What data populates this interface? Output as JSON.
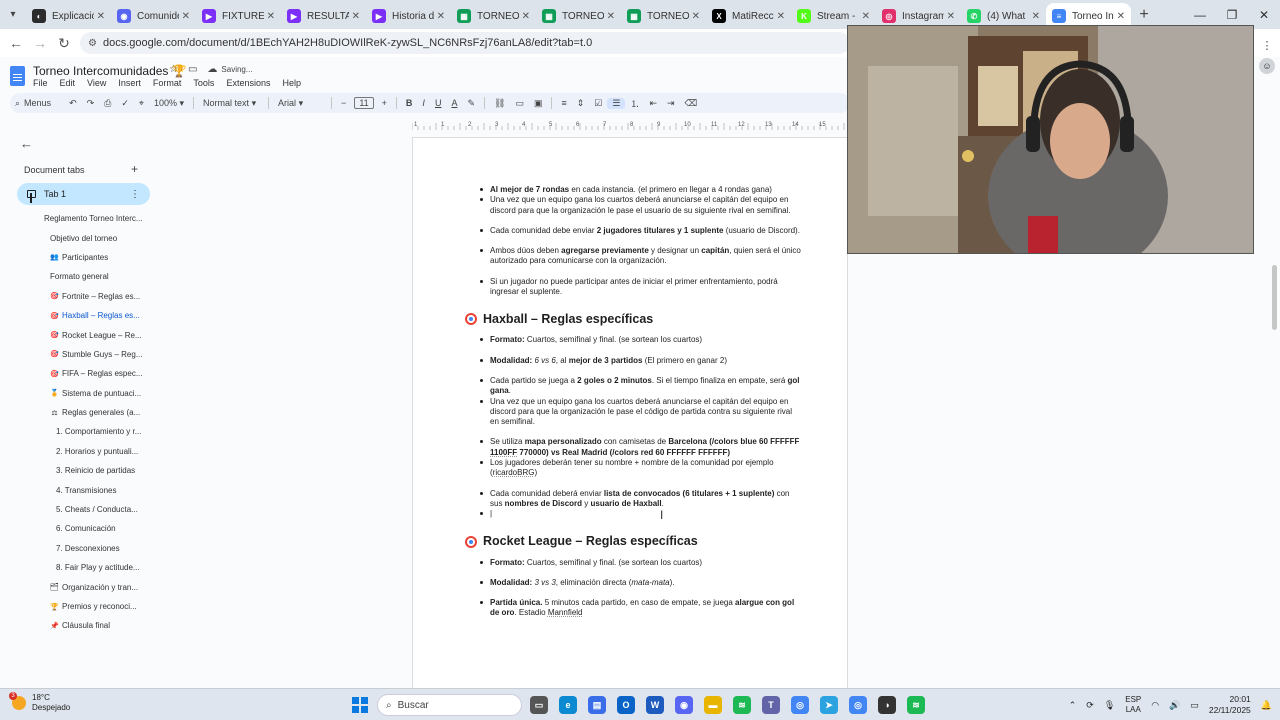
{
  "browser": {
    "tabs": [
      {
        "title": "Explicació",
        "color": "#2b2b2b",
        "glyph": "◐"
      },
      {
        "title": "Comunide",
        "color": "#5865f2",
        "glyph": "◉"
      },
      {
        "title": "FIXTURE",
        "color": "#7b2ff7",
        "glyph": "▶"
      },
      {
        "title": "RESULTAD",
        "color": "#7b2ff7",
        "glyph": "▶"
      },
      {
        "title": "Historia d",
        "color": "#7b2ff7",
        "glyph": "▶"
      },
      {
        "title": "TORNEO I",
        "color": "#0f9d58",
        "glyph": "▦"
      },
      {
        "title": "TORNEO I",
        "color": "#0f9d58",
        "glyph": "▦"
      },
      {
        "title": "TORNEO I",
        "color": "#0f9d58",
        "glyph": "▦"
      },
      {
        "title": "MatiRecch",
        "color": "#000000",
        "glyph": "X"
      },
      {
        "title": "Stream -",
        "color": "#53fc18",
        "glyph": "K"
      },
      {
        "title": "Instagram",
        "color": "#e1306c",
        "glyph": "◎"
      },
      {
        "title": "(4) What",
        "color": "#25d366",
        "glyph": "✆"
      },
      {
        "title": "Torneo Int",
        "color": "#4285f4",
        "glyph": "≡"
      }
    ],
    "close_glyph": "✕",
    "url": "docs.google.com/document/d/1BEchYAH2H8uDIOWIlReK-zywSL_NC6NRsFzj76anLA8/edit?tab=t.0",
    "back_glyph": "←",
    "forward_glyph": "→",
    "reload_glyph": "↻",
    "menu_glyph": "▾",
    "new_tab_glyph": "+",
    "minimize": "—",
    "maximize": "❐",
    "close": "✕"
  },
  "doc": {
    "title": "Torneo Intercomunidades 🏆",
    "star": "☆",
    "status": "Saving...",
    "menus": [
      "File",
      "Edit",
      "View",
      "Insert",
      "Format",
      "Tools",
      "Extensions",
      "Help"
    ]
  },
  "toolbar": {
    "search": "Menus",
    "zoom": "100%",
    "style": "Normal text",
    "font": "Arial",
    "font_size": "11",
    "minus": "−",
    "plus": "+",
    "undo": "↶",
    "redo": "↷",
    "print": "⎙",
    "spell": "✓",
    "paint": "⌖",
    "bold": "B",
    "italic": "I",
    "underline": "U",
    "textcolor": "A",
    "highlight": "✎",
    "link": "⛓",
    "comment": "▭",
    "image": "▣",
    "align": "≡",
    "linespacing": "⇕",
    "checklist": "☑",
    "bullets": "☰",
    "numbered": "⒈",
    "indent_less": "⇤",
    "indent_more": "⇥",
    "clear": "⌫"
  },
  "sidebar": {
    "back": "←",
    "header": "Document tabs",
    "add": "+",
    "active_tab": "Tab 1",
    "kebab": "⋮",
    "outline": [
      {
        "label": "Reglamento Torneo Interc...",
        "indent": 44,
        "emoji": "",
        "active": false
      },
      {
        "label": "Objetivo del torneo",
        "indent": 50,
        "emoji": "",
        "active": false
      },
      {
        "label": "Participantes",
        "indent": 50,
        "emoji": "👥",
        "active": false
      },
      {
        "label": "Formato general",
        "indent": 50,
        "emoji": "",
        "active": false
      },
      {
        "label": "Fortnite – Reglas es...",
        "indent": 50,
        "emoji": "🎯",
        "active": false
      },
      {
        "label": "Haxball – Reglas es...",
        "indent": 50,
        "emoji": "🎯",
        "active": true
      },
      {
        "label": "Rocket League – Re...",
        "indent": 50,
        "emoji": "🎯",
        "active": false
      },
      {
        "label": "Stumble Guys – Reg...",
        "indent": 50,
        "emoji": "🎯",
        "active": false
      },
      {
        "label": "FIFA – Reglas espec...",
        "indent": 50,
        "emoji": "🎯",
        "active": false
      },
      {
        "label": "Sistema de puntuaci...",
        "indent": 50,
        "emoji": "🏅",
        "active": false
      },
      {
        "label": "Reglas generales (a...",
        "indent": 50,
        "emoji": "⚖",
        "active": false
      },
      {
        "label": "1. Comportamiento y r...",
        "indent": 56,
        "emoji": "",
        "active": false
      },
      {
        "label": "2. Horarios y puntuali...",
        "indent": 56,
        "emoji": "",
        "active": false
      },
      {
        "label": "3. Reinicio de partidas",
        "indent": 56,
        "emoji": "",
        "active": false
      },
      {
        "label": "4. Transmisiones",
        "indent": 56,
        "emoji": "",
        "active": false
      },
      {
        "label": "5. Cheats / Conducta...",
        "indent": 56,
        "emoji": "",
        "active": false
      },
      {
        "label": "6. Comunicación",
        "indent": 56,
        "emoji": "",
        "active": false
      },
      {
        "label": "7. Desconexiones",
        "indent": 56,
        "emoji": "",
        "active": false
      },
      {
        "label": "8. Fair Play y actitude...",
        "indent": 56,
        "emoji": "",
        "active": false
      },
      {
        "label": "Organización y tran...",
        "indent": 50,
        "emoji": "🗂",
        "active": false
      },
      {
        "label": "Premios y reconoci...",
        "indent": 50,
        "emoji": "🏆",
        "active": false
      },
      {
        "label": "Cláusula final",
        "indent": 50,
        "emoji": "📌",
        "active": false
      }
    ]
  },
  "content": {
    "top_items": [
      {
        "html": "<b>Al mejor de 7 rondas</b> en cada instancia. (el primero en llegar a 4 rondas gana)"
      },
      {
        "html": "Una vez que un equipo gana los cuartos deberá anunciarse el capitán del equipo en discord para que la organización le pase el usuario de su siguiente rival en semifinal."
      },
      {
        "html": "Cada comunidad debe enviar <b>2 jugadores titulares y 1 suplente</b> (usuario de Discord).",
        "gap": true
      },
      {
        "html": "Ambos dúos deben <b>agregarse previamente</b> y designar un <b>capitán</b>, quien será el único autorizado para comunicarse con la organización.",
        "gap": true
      },
      {
        "html": "Si un jugador no puede participar antes de iniciar el primer enfrentamiento, podrá ingresar el suplente.",
        "gap": true
      }
    ],
    "haxball_heading": "Haxball – Reglas específicas",
    "haxball_items": [
      {
        "html": "<b>Formato:</b> Cuartos, semifinal y final. (se sortean los cuartos)"
      },
      {
        "html": "<b>Modalidad:</b> <i>6 vs 6</i>, al <b>mejor de 3 partidos</b> (El primero en ganar 2)",
        "gap": true
      },
      {
        "html": "Cada partido se juega a <b>2 goles o 2 minutos</b>. Si el tiempo finaliza en empate, será <b>gol gana</b>.",
        "gap": true
      },
      {
        "html": "Una vez que un equipo gana los cuartos deberá anunciarse el capitán del equipo en discord para que la organización le pase el código de partida contra su siguiente rival en semifinal."
      },
      {
        "html": "Se utiliza <b>mapa personalizado</b> con camisetas de <b>Barcelona (/colors blue 60 FFFFFF <u class=\"dot\">1100FF</u> 770000) vs Real Madrid (/colors red 60 FFFFFF FFFFFF)</b>",
        "gap": true
      },
      {
        "html": "Los jugadores deberán tener su nombre + nombre de la comunidad por ejemplo (<u class=\"dot\">ricardoBRG</u>)"
      },
      {
        "html": "Cada comunidad deberá enviar <b>lista de convocados (6 titulares + 1 suplente)</b> con sus <b>nombres de Discord</b> y <b>usuario de Haxball</b>.",
        "gap": true
      },
      {
        "html": "|"
      }
    ],
    "rocket_heading": "Rocket League – Reglas específicas",
    "rocket_items": [
      {
        "html": "<b>Formato:</b> Cuartos, semifinal y final. (se sortean los cuartos)"
      },
      {
        "html": "<b>Modalidad:</b> <i>3 vs 3</i>, eliminación directa (<i>mata-mata</i>).",
        "gap": true
      },
      {
        "html": "<b>Partida única.</b> 5 minutos cada partido, en caso de empate, se juega <b>alargue con gol de oro</b>. Estadio <u class=\"dot\">Mannfield</u>",
        "gap": true
      }
    ]
  },
  "ruler": {
    "marks": [
      "1",
      "1",
      "2",
      "3",
      "4",
      "5",
      "6",
      "7",
      "8",
      "9",
      "10",
      "11",
      "12",
      "13",
      "14",
      "15"
    ]
  },
  "taskbar": {
    "temp": "18°C",
    "weather": "Despejado",
    "badge": "3",
    "search": "Buscar",
    "lang1": "ESP",
    "lang2": "LAA",
    "time": "20:01",
    "date": "22/11/2025",
    "chevron": "⌃",
    "apps": [
      {
        "name": "file-explorer-dark",
        "color": "#555",
        "glyph": "▭"
      },
      {
        "name": "edge",
        "color": "#0c8ad1",
        "glyph": "e"
      },
      {
        "name": "store",
        "color": "#3a6ee8",
        "glyph": "▤"
      },
      {
        "name": "outlook",
        "color": "#0a64c8",
        "glyph": "O"
      },
      {
        "name": "word",
        "color": "#1d5bbf",
        "glyph": "W"
      },
      {
        "name": "discord",
        "color": "#5865f2",
        "glyph": "◉"
      },
      {
        "name": "folder",
        "color": "#e8b500",
        "glyph": "▬"
      },
      {
        "name": "spotify",
        "color": "#1db954",
        "glyph": "≋"
      },
      {
        "name": "teams",
        "color": "#6264a7",
        "glyph": "T"
      },
      {
        "name": "chrome",
        "color": "#4285f4",
        "glyph": "◎"
      },
      {
        "name": "telegram",
        "color": "#2aa3e0",
        "glyph": "➤"
      },
      {
        "name": "chrome-2",
        "color": "#4285f4",
        "glyph": "◎"
      },
      {
        "name": "obs",
        "color": "#333",
        "glyph": "◑"
      },
      {
        "name": "spotify-2",
        "color": "#1db954",
        "glyph": "≋"
      }
    ]
  }
}
